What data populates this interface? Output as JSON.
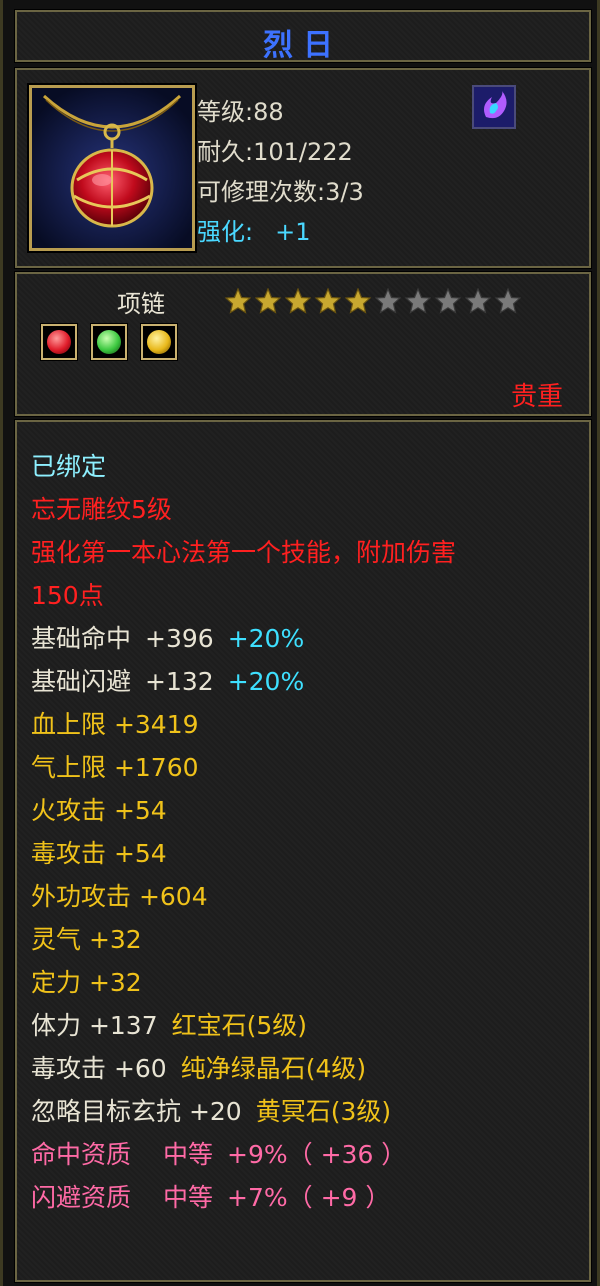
{
  "item": {
    "name": "烈日",
    "level": "等级:88",
    "durability": "耐久:101/222",
    "repair": "可修理次数:3/3",
    "enhance_label": "强化:",
    "enhance_value": "+1",
    "type": "项链",
    "stars_filled": 5,
    "stars_total": 10,
    "rarity": "贵重",
    "gem_slots": [
      {
        "color": "#e01c2a",
        "icon": "red-gem-icon"
      },
      {
        "color": "#3cc840",
        "icon": "green-gem-icon"
      },
      {
        "color": "#e8b81a",
        "icon": "yellow-gem-icon"
      }
    ]
  },
  "attrs": {
    "bound": "已绑定",
    "engrave": "忘无雕纹5级",
    "skill_line1": "强化第一本心法第一个技能，附加伤害",
    "skill_line2": "150点",
    "hit_label": "基础命中",
    "hit_value": "+396",
    "hit_bonus": "+20%",
    "dodge_label": "基础闪避",
    "dodge_value": "+132",
    "dodge_bonus": "+20%",
    "hp": "血上限  +3419",
    "qi": "气上限  +1760",
    "fire": "火攻击  +54",
    "poison": "毒攻击  +54",
    "external": "外功攻击  +604",
    "spirit": "灵气  +32",
    "focus": "定力  +32",
    "gem1_stat": "体力  +137",
    "gem1_name": "红宝石(5级)",
    "gem2_stat": "毒攻击  +60",
    "gem2_name": "纯净绿晶石(4级)",
    "gem3_stat": "忽略目标玄抗  +20",
    "gem3_name": "黄冥石(3级)",
    "apt1_label": "命中资质",
    "apt1_grade": "中等",
    "apt1_value": "+9%（ +36 ）",
    "apt2_label": "闪避资质",
    "apt2_grade": "中等",
    "apt2_value": "+7%（ +9 ）"
  }
}
